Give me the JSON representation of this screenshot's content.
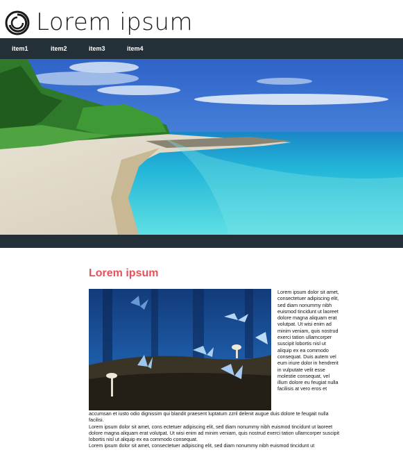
{
  "header": {
    "logo_icon": "circular-swirl-icon",
    "site_title": "Lorem ipsum"
  },
  "nav": {
    "items": [
      {
        "label": "item1"
      },
      {
        "label": "item2"
      },
      {
        "label": "item3"
      },
      {
        "label": "item4"
      }
    ]
  },
  "hero": {
    "image_subject": "tropical-beach-photo"
  },
  "main": {
    "title": "Lorem ipsum",
    "image_subject": "blue-butterflies-mushrooms-photo",
    "side_text": "Lorem ipsum dolor sit amet, consectetuer adipiscing elit, sed diam nonummy nibh euismod tincidunt ut laoreet dolore magna aliquam erat volutpat. Ut wisi enim ad minim veniam, quis nostrud exerci tation ullamcorper suscipit lobortis nisl ut aliquip ex ea commodo consequat. Duis autem vel eum iriure dolor in hendrerit in vulputate velit esse molestie consequat, vel illum dolore eu feugiat nulla facilisis at vero eros et",
    "continued_text": "accumsan et iusto odio dignissim qui blandit praesent luptatum zzril delenit augue duis dolore te feugait nulla facilisi.",
    "paragraph_2": "Lorem ipsum dolor sit amet, cons ectetuer adipiscing elit, sed diam nonummy nibh euismod tincidunt ut laoreet dolore magna aliquam erat volutpat. Ut wisi enim ad minim veniam, quis nostrud exerci tation ullamcorper suscipit lobortis nisl ut aliquip ex ea commodo consequat.",
    "paragraph_3": "Lorem ipsum dolor sit amet, consectetuer adipiscing elit, sed diam nonummy nibh euismod tincidunt ut"
  },
  "colors": {
    "nav_background": "#243038",
    "accent_title": "#e8505b",
    "text": "#111111"
  }
}
